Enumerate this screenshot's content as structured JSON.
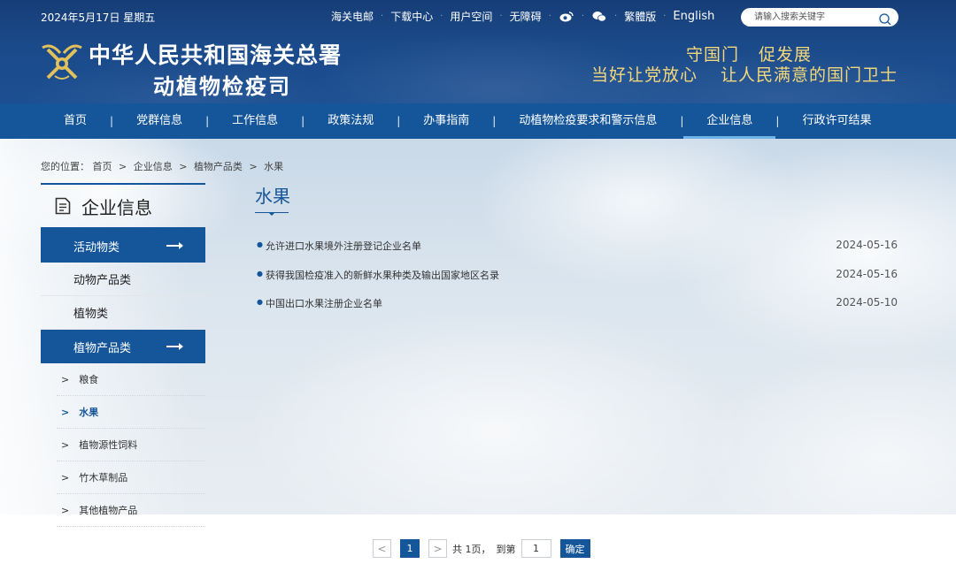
{
  "header": {
    "date": "2024年5月17日 星期五",
    "top_links": {
      "mail": "海关电邮",
      "download": "下载中心",
      "user": "用户空间",
      "accessible": "无障碍",
      "traditional": "繁體版",
      "english": "English"
    },
    "search_placeholder": "请输入搜索关键字",
    "org_line1": "中华人民共和国海关总署",
    "org_line2": "动植物检疫司",
    "slogan_top": [
      "守国门",
      "促发展"
    ],
    "slogan_bottom": [
      "当好让党放心",
      "让人民满意的国门卫士"
    ]
  },
  "nav": {
    "items": [
      "首页",
      "党群信息",
      "工作信息",
      "政策法规",
      "办事指南",
      "动植物检疫要求和警示信息",
      "企业信息",
      "行政许可结果"
    ],
    "active": "企业信息"
  },
  "breadcrumb": {
    "prefix": "您的位置：",
    "items": [
      "首页",
      "企业信息",
      "植物产品类",
      "水果"
    ]
  },
  "sidebar": {
    "title": "企业信息",
    "categories": [
      {
        "label": "活动物类"
      },
      {
        "label": "动物产品类"
      },
      {
        "label": "植物类"
      },
      {
        "label": "植物产品类"
      }
    ],
    "subitems": [
      {
        "label": "粮食"
      },
      {
        "label": "水果"
      },
      {
        "label": "植物源性饲料"
      },
      {
        "label": "竹木草制品"
      },
      {
        "label": "其他植物产品"
      }
    ]
  },
  "main": {
    "title": "水果",
    "articles": [
      {
        "title": "允许进口水果境外注册登记企业名单",
        "date": "2024-05-16"
      },
      {
        "title": "获得我国检疫准入的新鲜水果种类及输出国家地区名录",
        "date": "2024-05-16"
      },
      {
        "title": "中国出口水果注册企业名单",
        "date": "2024-05-10"
      }
    ]
  },
  "pagination": {
    "prev": "<",
    "current_page": "1",
    "next": ">",
    "total_text": "共 1页，",
    "goto_label": "到第",
    "goto_value": "1",
    "confirm": "确定"
  },
  "colors": {
    "primary": "#15569b",
    "header_bg": "#1b4a8a",
    "slogan": "#f4d77a"
  }
}
